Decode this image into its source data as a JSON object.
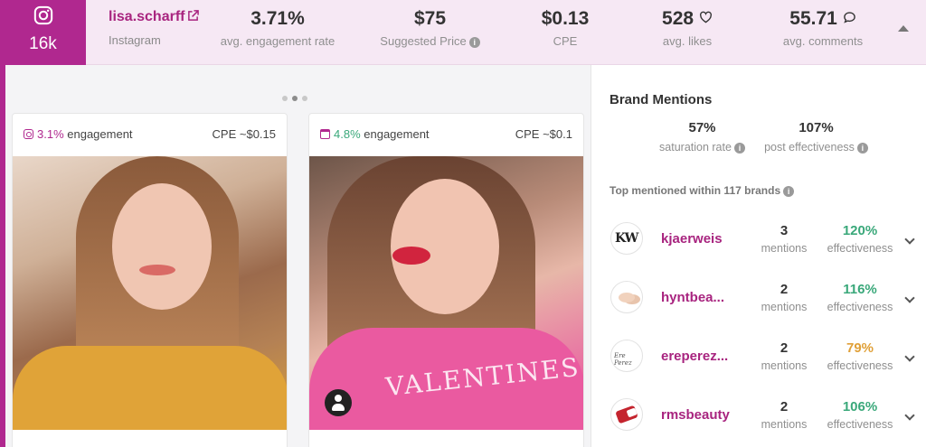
{
  "header": {
    "platform_icon": "instagram-icon",
    "followers": "16k",
    "handle": "lisa.scharff",
    "platform": "Instagram",
    "stats": [
      {
        "id": "engagement",
        "value": "3.71%",
        "label": "avg. engagement rate",
        "info": false,
        "icon": null
      },
      {
        "id": "price",
        "value": "$75",
        "label": "Suggested Price",
        "info": true,
        "icon": null
      },
      {
        "id": "cpe",
        "value": "$0.13",
        "label": "CPE",
        "info": false,
        "icon": null
      },
      {
        "id": "likes",
        "value": "528",
        "label": "avg. likes",
        "info": false,
        "icon": "heart-icon"
      },
      {
        "id": "comments",
        "value": "55.71",
        "label": "avg. comments",
        "info": false,
        "icon": "comment-icon"
      }
    ]
  },
  "posts": [
    {
      "engagement_pct": "3.1%",
      "engagement_label": "engagement",
      "cpe": "CPE ~$0.15",
      "type_icon": "instagram-icon",
      "pct_color": "#b0288f"
    },
    {
      "engagement_pct": "4.8%",
      "engagement_label": "engagement",
      "cpe": "CPE ~$0.1",
      "type_icon": "calendar-icon",
      "pct_color": "#3aa87a",
      "overlay_text": "VALENTINES"
    }
  ],
  "carousel": {
    "count": 3,
    "active": 1
  },
  "brand_mentions": {
    "title": "Brand Mentions",
    "saturation": {
      "value": "57%",
      "label": "saturation rate"
    },
    "post_effectiveness": {
      "value": "107%",
      "label": "post effectiveness"
    },
    "top_mentioned": "Top mentioned within 117 brands",
    "brands": [
      {
        "name": "kjaerweis",
        "mentions": "3",
        "mentions_label": "mentions",
        "effectiveness": "120%",
        "eff_label": "effectiveness",
        "color": "#3aa87a"
      },
      {
        "name": "hyntbea...",
        "mentions": "2",
        "mentions_label": "mentions",
        "effectiveness": "116%",
        "eff_label": "effectiveness",
        "color": "#3aa87a"
      },
      {
        "name": "ereperez...",
        "mentions": "2",
        "mentions_label": "mentions",
        "effectiveness": "79%",
        "eff_label": "effectiveness",
        "color": "#e0a038"
      },
      {
        "name": "rmsbeauty",
        "mentions": "2",
        "mentions_label": "mentions",
        "effectiveness": "106%",
        "eff_label": "effectiveness",
        "color": "#3aa87a"
      }
    ]
  }
}
